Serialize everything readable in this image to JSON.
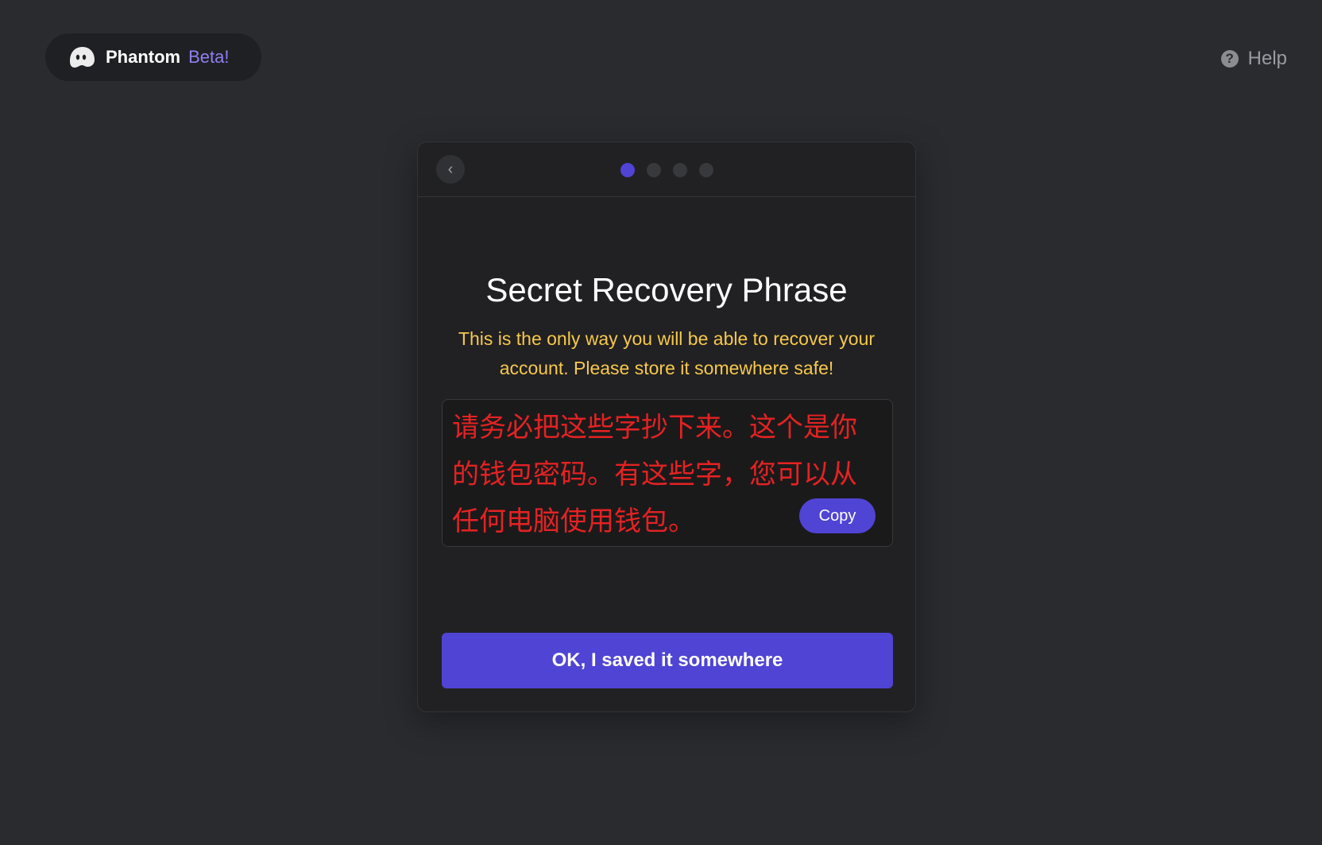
{
  "brand": {
    "name": "Phantom",
    "badge": "Beta!",
    "logo_icon": "ghost-icon"
  },
  "header": {
    "help_label": "Help",
    "help_icon": "question-circle-icon"
  },
  "card": {
    "back_icon": "chevron-left-icon",
    "back_glyph": "‹",
    "steps": {
      "total": 4,
      "current": 1
    },
    "title": "Secret Recovery Phrase",
    "warning": "This is the only way you will be able to recover your account. Please store it somewhere safe!",
    "phrase": "请务必把这些字抄下来。这个是你的钱包密码。有这些字，您可以从任何电脑使用钱包。",
    "copy_label": "Copy",
    "confirm_label": "OK, I saved it somewhere"
  },
  "colors": {
    "background": "#2a2b2f",
    "card": "#212123",
    "accent": "#4f44d4",
    "beta": "#8f7ff5",
    "warning": "#f7c84a",
    "phrase": "#e52222"
  }
}
